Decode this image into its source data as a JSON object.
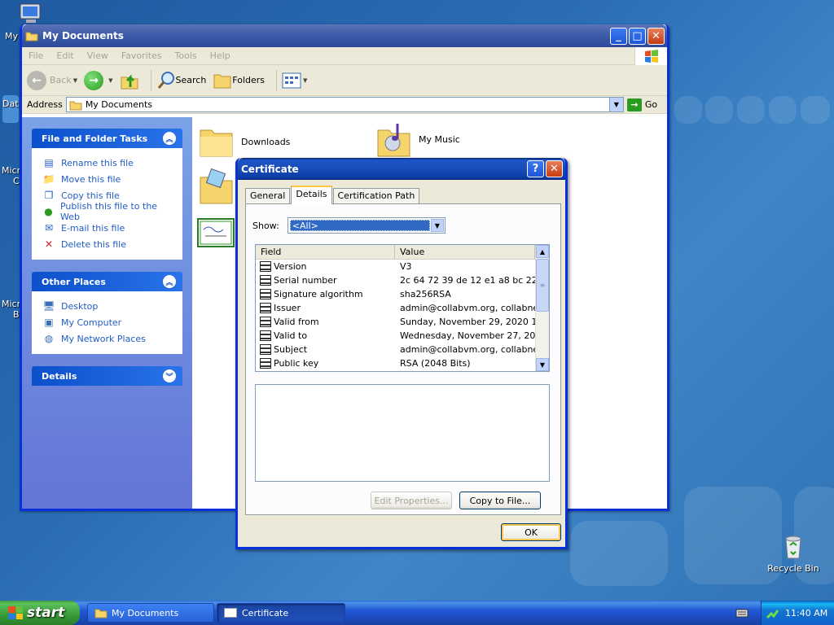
{
  "desktop": {
    "icons": [
      {
        "label": "My"
      },
      {
        "label": "Dat"
      },
      {
        "label": "Micro"
      },
      {
        "label": "C"
      },
      {
        "label": "Micro"
      },
      {
        "label": "B"
      }
    ],
    "recycle_bin": "Recycle Bin"
  },
  "explorer": {
    "title": "My Documents",
    "menu": [
      "File",
      "Edit",
      "View",
      "Favorites",
      "Tools",
      "Help"
    ],
    "toolbar": {
      "back": "Back",
      "search": "Search",
      "folders": "Folders"
    },
    "address": {
      "label": "Address",
      "value": "My Documents",
      "go": "Go"
    },
    "file_tasks": {
      "title": "File and Folder Tasks",
      "items": [
        "Rename this file",
        "Move this file",
        "Copy this file",
        "Publish this file to the Web",
        "E-mail this file",
        "Delete this file"
      ]
    },
    "other_places": {
      "title": "Other Places",
      "items": [
        "Desktop",
        "My Computer",
        "My Network Places"
      ]
    },
    "details": {
      "title": "Details"
    },
    "folders": [
      "Downloads",
      "My Music"
    ]
  },
  "certificate": {
    "title": "Certificate",
    "tabs": [
      "General",
      "Details",
      "Certification Path"
    ],
    "show_label": "Show:",
    "show_value": "<All>",
    "columns": [
      "Field",
      "Value"
    ],
    "rows": [
      {
        "field": "Version",
        "value": "V3"
      },
      {
        "field": "Serial number",
        "value": "2c 64 72 39 de 12 e1 a8 bc 22..."
      },
      {
        "field": "Signature algorithm",
        "value": "sha256RSA"
      },
      {
        "field": "Issuer",
        "value": "admin@collabvm.org, collabne..."
      },
      {
        "field": "Valid from",
        "value": "Sunday, November 29, 2020 1..."
      },
      {
        "field": "Valid to",
        "value": "Wednesday, November 27, 20..."
      },
      {
        "field": "Subject",
        "value": "admin@collabvm.org, collabne..."
      },
      {
        "field": "Public key",
        "value": "RSA (2048 Bits)"
      }
    ],
    "edit_properties": "Edit Properties...",
    "copy_to_file": "Copy to File...",
    "ok": "OK"
  },
  "taskbar": {
    "start": "start",
    "tasks": [
      "My Documents",
      "Certificate"
    ],
    "clock": "11:40 AM"
  },
  "colors": {
    "title_active": "#0a246a",
    "link": "#215dc6",
    "taskbar": "#2157d7",
    "start": "#379a37"
  }
}
